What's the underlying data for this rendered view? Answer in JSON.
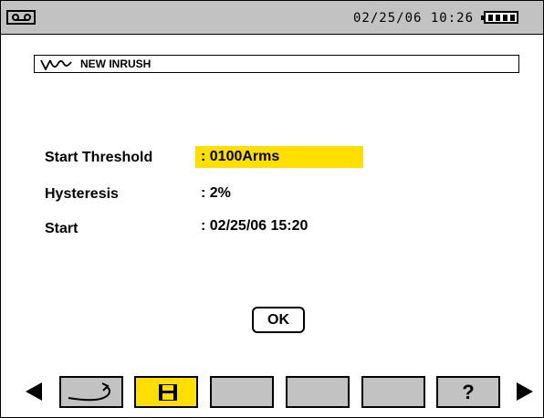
{
  "status_bar": {
    "datetime": "02/25/06  10:26",
    "icons": [
      "cassette-icon",
      "battery-icon"
    ]
  },
  "title": {
    "icon": "inrush-wave-icon",
    "text": "NEW INRUSH"
  },
  "form": {
    "start_threshold": {
      "label": "Start Threshold",
      "value": ":  0100Arms"
    },
    "hysteresis": {
      "label": "Hysteresis",
      "value": ":  2%"
    },
    "start": {
      "label": "Start",
      "value": ":  02/25/06   15:20"
    }
  },
  "ok_label": "OK",
  "softkeys": {
    "left_arrow_icon": "left-arrow-icon",
    "right_arrow_icon": "right-arrow-icon",
    "keys": [
      {
        "icon": "return-icon"
      },
      {
        "icon": "save-icon",
        "active": true
      },
      {
        "icon": ""
      },
      {
        "icon": ""
      },
      {
        "icon": ""
      },
      {
        "icon": "help-icon",
        "label": "?"
      }
    ]
  },
  "colors": {
    "highlight": "#ffde00",
    "bar_gray": "#c2c2c2"
  }
}
